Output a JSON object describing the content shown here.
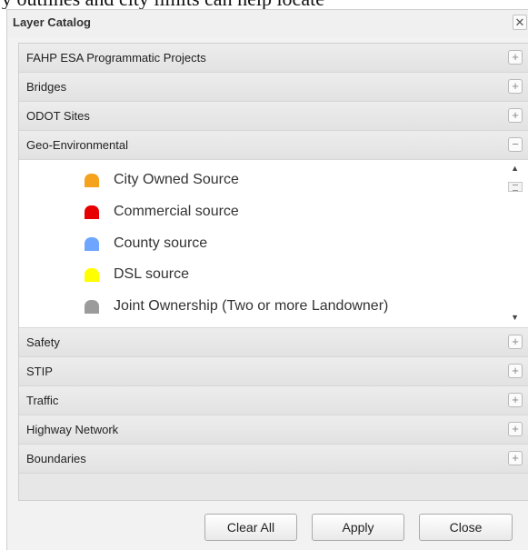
{
  "background": {
    "text": "y outlines and city limits can help locate"
  },
  "dialog": {
    "title": "Layer Catalog",
    "close_glyph": "✕"
  },
  "groups_above": [
    {
      "label": "FAHP ESA Programmatic Projects",
      "toggle": "+"
    },
    {
      "label": "Bridges",
      "toggle": "+"
    },
    {
      "label": "ODOT Sites",
      "toggle": "+"
    },
    {
      "label": "Geo-Environmental",
      "toggle": "−"
    }
  ],
  "legend": [
    {
      "label": "City Owned Source",
      "color": "#f5a21c"
    },
    {
      "label": "Commercial source",
      "color": "#e60000"
    },
    {
      "label": "County source",
      "color": "#6ea6ff"
    },
    {
      "label": "DSL source",
      "color": "#ffff00"
    },
    {
      "label": "Joint Ownership (Two or more Landowner)",
      "color": "#9b9b9b"
    }
  ],
  "scroll": {
    "up_icon": "▲",
    "down_icon": "▼"
  },
  "groups_below": [
    {
      "label": "Safety",
      "toggle": "+"
    },
    {
      "label": "STIP",
      "toggle": "+"
    },
    {
      "label": "Traffic",
      "toggle": "+"
    },
    {
      "label": "Highway Network",
      "toggle": "+"
    },
    {
      "label": "Boundaries",
      "toggle": "+"
    }
  ],
  "buttons": {
    "clear_all": "Clear All",
    "apply": "Apply",
    "close": "Close"
  }
}
